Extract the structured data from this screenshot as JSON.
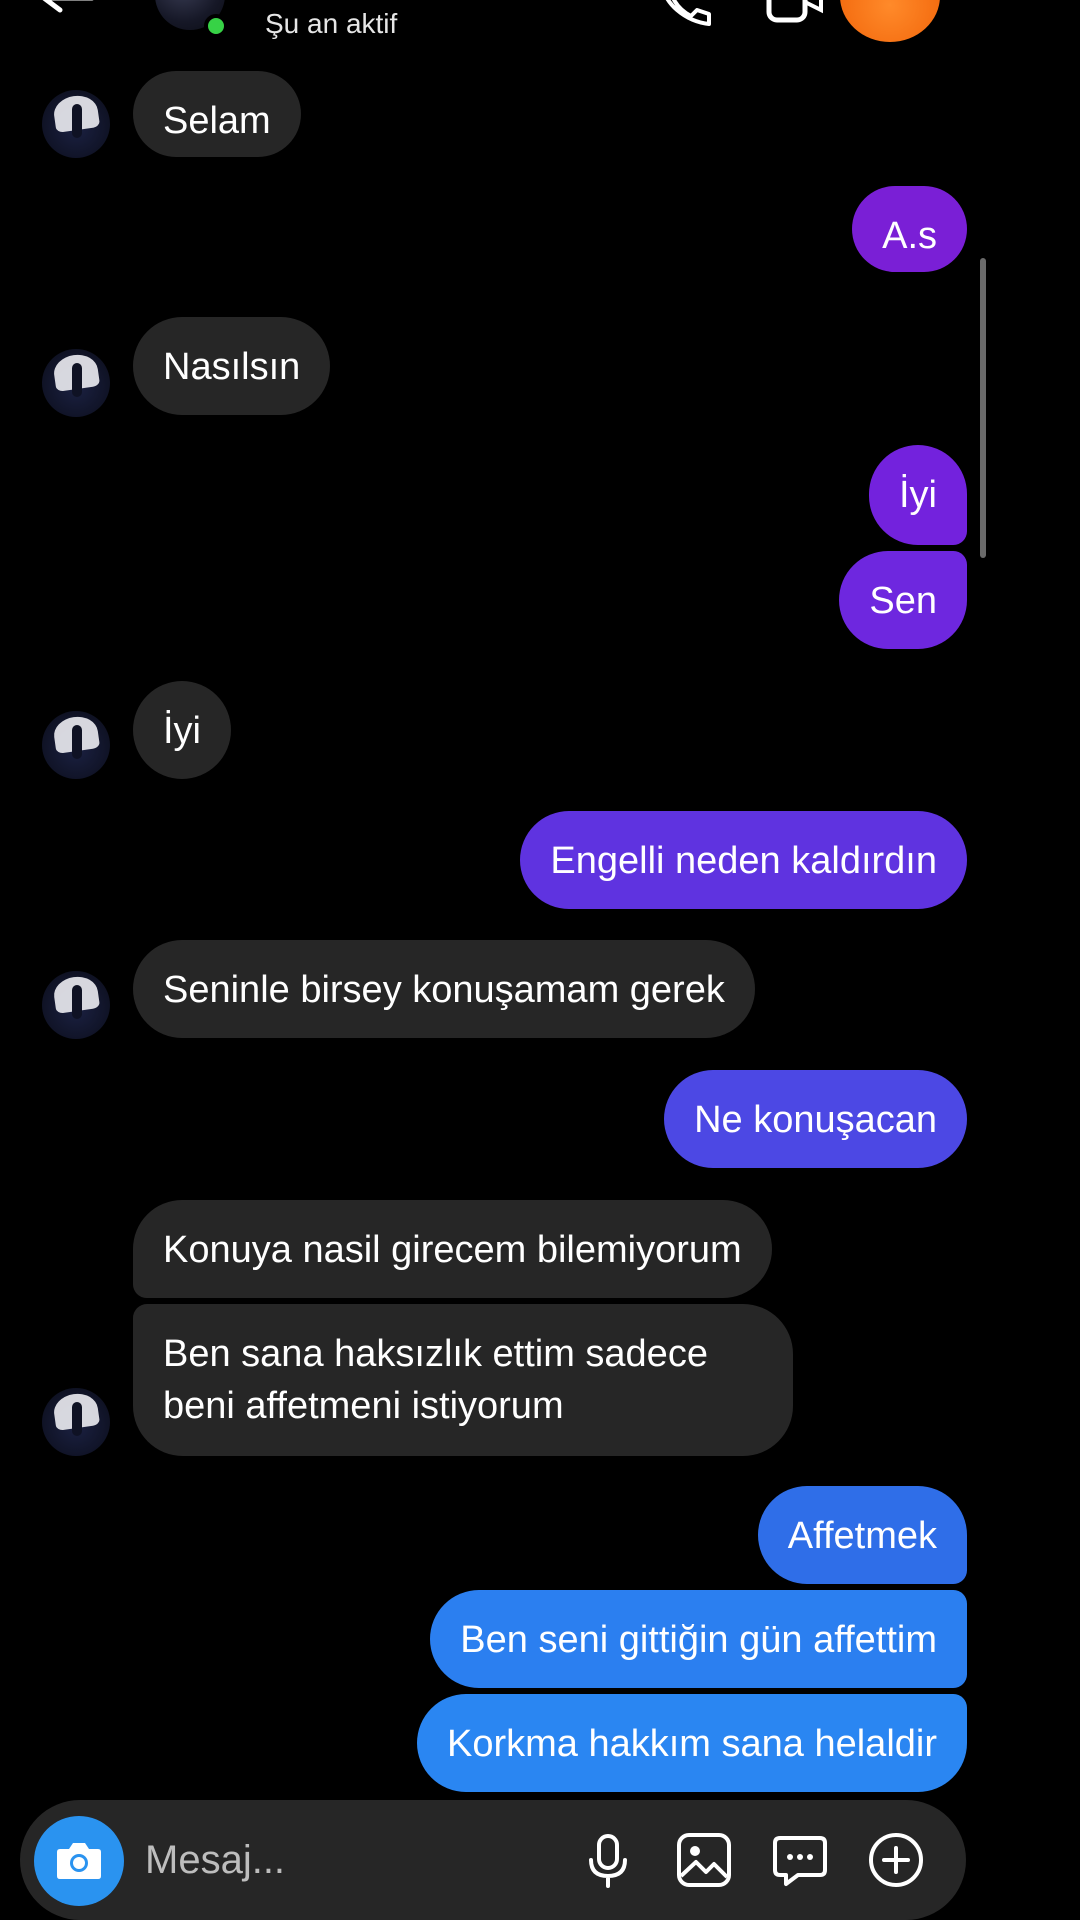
{
  "header": {
    "status_text": "Şu an aktif",
    "icons": [
      "back-arrow-icon",
      "phone-icon",
      "video-camera-icon"
    ]
  },
  "messages": [
    {
      "side": "in",
      "text": "Selam"
    },
    {
      "side": "out",
      "text": "A.s",
      "color": "#7a1fd6"
    },
    {
      "side": "in",
      "text": "Nasılsın"
    },
    {
      "side": "out",
      "text": "İyi",
      "color": "#7322dd"
    },
    {
      "side": "out",
      "text": "Sen",
      "color": "#6e27df"
    },
    {
      "side": "in",
      "text": "İyi"
    },
    {
      "side": "out",
      "text": "Engelli neden kaldırdın",
      "color": "#5f33e0"
    },
    {
      "side": "in",
      "text": "Seninle birsey konuşamam gerek"
    },
    {
      "side": "out",
      "text": "Ne konuşacan",
      "color": "#4c48e4"
    },
    {
      "side": "in",
      "text": "Konuya nasil girecem bilemiyorum"
    },
    {
      "side": "in",
      "text": "Ben sana haksızlık ettim sadece beni affetmeni istiyorum"
    },
    {
      "side": "out",
      "text": "Affetmek",
      "color": "#2f6ee8"
    },
    {
      "side": "out",
      "text": "Ben seni gittiğin gün affettim",
      "color": "#2b7ff0"
    },
    {
      "side": "out",
      "text": "Korkma hakkım sana helaldir",
      "color": "#2a86f2"
    }
  ],
  "composer": {
    "placeholder": "Mesaj...",
    "icons": [
      "camera-icon",
      "microphone-icon",
      "gallery-icon",
      "sticker-chat-icon",
      "plus-icon"
    ]
  },
  "colors": {
    "background": "#000000",
    "incoming_bubble": "#262626",
    "online": "#37d246",
    "camera_button": "#2a93f0"
  }
}
